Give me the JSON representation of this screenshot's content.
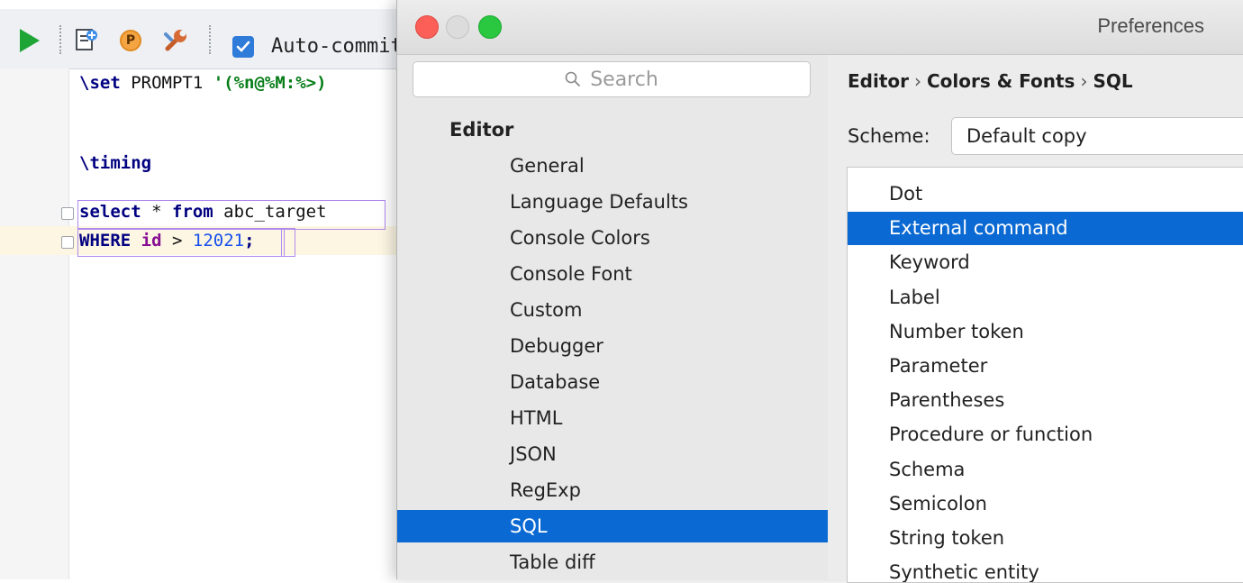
{
  "ide": {
    "autocommit_label": "Auto-commit",
    "autocommit_checked": true,
    "code": {
      "line1": {
        "cmd": "\\set",
        "rest": " PROMPT1 ",
        "str": "'(%n@%M:%>)"
      },
      "line2": {
        "cmd": "\\timing"
      },
      "line3": {
        "kw1": "select",
        "mid": " * ",
        "kw2": "from",
        "rest": " abc_target"
      },
      "line4": {
        "kw": "WHERE",
        "col": "id",
        "op": " > ",
        "num": "12021",
        "end": ";"
      }
    }
  },
  "prefs": {
    "window_title": "Preferences",
    "search_placeholder": "Search",
    "section": "Editor",
    "nav_items": [
      "General",
      "Language Defaults",
      "Console Colors",
      "Console Font",
      "Custom",
      "Debugger",
      "Database",
      "HTML",
      "JSON",
      "RegExp",
      "SQL",
      "Table diff"
    ],
    "selected_nav": "SQL",
    "breadcrumb": [
      "Editor",
      "Colors & Fonts",
      "SQL"
    ],
    "scheme_label": "Scheme:",
    "scheme_value": "Default copy",
    "elements": [
      "Dot",
      "External command",
      "Keyword",
      "Label",
      "Number token",
      "Parameter",
      "Parentheses",
      "Procedure or function",
      "Schema",
      "Semicolon",
      "String token",
      "Synthetic entity"
    ],
    "selected_element": "External command",
    "accent_color": "#0a69d2"
  }
}
